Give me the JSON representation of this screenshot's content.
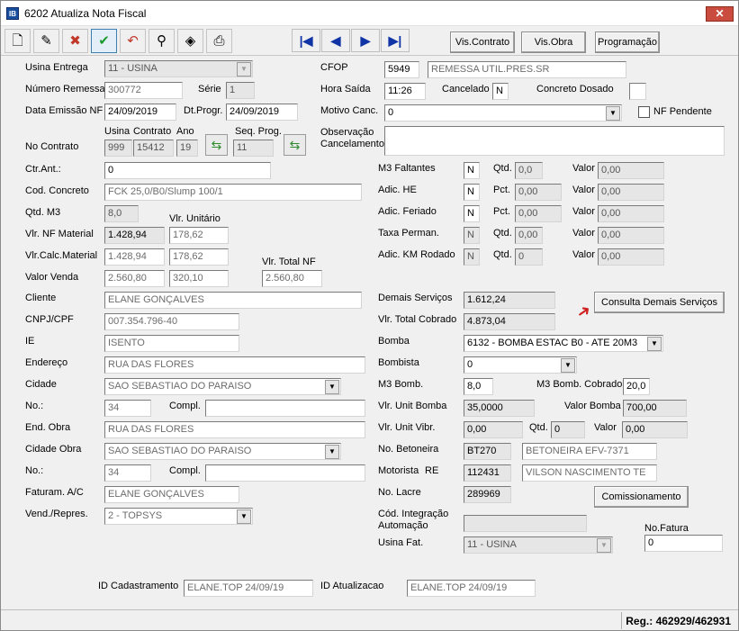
{
  "window": {
    "title": "6202 Atualiza Nota Fiscal",
    "app_icon": "IB",
    "close": "✕"
  },
  "toolbar": {
    "buttons": [
      "new-document-icon",
      "edit-icon",
      "cancel-icon",
      "confirm-check-icon",
      "undo-icon",
      "binoculars-search-icon",
      "eraser-icon",
      "printer-icon"
    ],
    "nav": [
      "first-record-icon",
      "previous-record-icon",
      "next-record-icon",
      "last-record-icon"
    ],
    "vis_contrato": "Vis.Contrato",
    "vis_obra": "Vis.Obra",
    "programacao": "Programação"
  },
  "left": {
    "usina_entrega_label": "Usina Entrega",
    "usina_entrega": "11 - USINA",
    "numero_remessa_label": "Número Remessa",
    "numero_remessa": "300772",
    "serie_label": "Série",
    "serie": "1",
    "data_emissao_label": "Data Emissão NF",
    "data_emissao": "24/09/2019",
    "dt_progr_label": "Dt.Progr.",
    "dt_progr": "24/09/2019",
    "usina_col": "Usina",
    "contrato_col": "Contrato",
    "ano_col": "Ano",
    "no_contrato_label": "No Contrato",
    "contrato_usina": "999",
    "contrato_num": "15412",
    "contrato_ano": "19",
    "seq_prog_label": "Seq. Prog.",
    "seq_prog": "11",
    "ctr_ant_label": "Ctr.Ant.:",
    "ctr_ant": "0",
    "cod_concreto_label": "Cod. Concreto",
    "cod_concreto": "FCK 25,0/B0/Slump 100/1",
    "qtd_m3_label": "Qtd. M3",
    "qtd_m3": "8,0",
    "vlr_unitario_label": "Vlr. Unitário",
    "vlr_nf_material_label": "Vlr. NF Material",
    "vlr_nf_material": "1.428,94",
    "vlr_nf_material_unit": "178,62",
    "vlr_calc_material_label": "Vlr.Calc.Material",
    "vlr_calc_material": "1.428,94",
    "vlr_calc_material_unit": "178,62",
    "vlr_total_nf_label": "Vlr. Total NF",
    "valor_venda_label": "Valor Venda",
    "valor_venda": "2.560,80",
    "valor_venda_unit": "320,10",
    "vlr_total_nf": "2.560,80",
    "cliente_label": "Cliente",
    "cliente": "ELANE GONÇALVES",
    "cnpj_label": "CNPJ/CPF",
    "cnpj": "007.354.796-40",
    "ie_label": "IE",
    "ie": "ISENTO",
    "endereco_label": "Endereço",
    "endereco": "RUA DAS FLORES",
    "cidade_label": "Cidade",
    "cidade": "SAO SEBASTIAO DO PARAISO",
    "no_label": "No.:",
    "no": "34",
    "compl_label": "Compl.",
    "compl": "",
    "end_obra_label": "End. Obra",
    "end_obra": "RUA DAS FLORES",
    "cidade_obra_label": "Cidade Obra",
    "cidade_obra": "SAO SEBASTIAO DO PARAISO",
    "no2_label": "No.:",
    "no2": "34",
    "compl2_label": "Compl.",
    "compl2": "",
    "faturam_label": "Faturam. A/C",
    "faturam": "ELANE GONÇALVES",
    "vend_label": "Vend./Repres.",
    "vend": "2 - TOPSYS"
  },
  "right": {
    "cfop_label": "CFOP",
    "cfop": "5949",
    "cfop_desc": "REMESSA UTIL.PRES.SR",
    "hora_saida_label": "Hora Saída",
    "hora_saida": "11:26",
    "cancelado_label": "Cancelado",
    "cancelado": "N",
    "concreto_dosado_label": "Concreto Dosado",
    "concreto_dosado": "",
    "motivo_canc_label": "Motivo Canc.",
    "motivo_canc": "0",
    "nf_pendente_label": "NF Pendente",
    "observacao_label": "Observação",
    "cancelamento_label": "Cancelamento",
    "observacao": "",
    "m3_faltantes_label": "M3 Faltantes",
    "m3_faltantes": "N",
    "adic_he_label": "Adic. HE",
    "adic_he": "N",
    "adic_feriado_label": "Adic. Feriado",
    "adic_feriado": "N",
    "taxa_perman_label": "Taxa Perman.",
    "taxa_perman": "N",
    "adic_km_label": "Adic. KM Rodado",
    "adic_km": "N",
    "qtd_label": "Qtd.",
    "pct_label": "Pct.",
    "valor_label": "Valor",
    "m3f_qtd": "0,0",
    "m3f_valor": "0,00",
    "he_pct": "0,00",
    "he_valor": "0,00",
    "fer_pct": "0,00",
    "fer_valor": "0,00",
    "tp_qtd": "0,00",
    "tp_valor": "0,00",
    "km_qtd": "0",
    "km_valor": "0,00",
    "demais_servicos_label": "Demais Serviços",
    "demais_servicos": "1.612,24",
    "consulta_demais": "Consulta Demais Serviços",
    "vlr_total_cobrado_label": "Vlr. Total Cobrado",
    "vlr_total_cobrado": "4.873,04",
    "bomba_label": "Bomba",
    "bomba": "6132 - BOMBA ESTAC B0 - ATE 20M3",
    "bombista_label": "Bombista",
    "bombista": "0",
    "m3_bomb_label": "M3 Bomb.",
    "m3_bomb": "8,0",
    "m3_bomb_cobrado_label": "M3 Bomb. Cobrado",
    "m3_bomb_cobrado": "20,0",
    "vlr_unit_bomba_label": "Vlr. Unit Bomba",
    "vlr_unit_bomba": "35,0000",
    "valor_bomba_label": "Valor Bomba",
    "valor_bomba": "700,00",
    "vlr_unit_vibr_label": "Vlr. Unit Vibr.",
    "vlr_unit_vibr": "0,00",
    "vibr_qtd_label": "Qtd.",
    "vibr_qtd": "0",
    "vibr_valor_label": "Valor",
    "vibr_valor": "0,00",
    "no_betoneira_label": "No. Betoneira",
    "no_betoneira": "BT270",
    "betoneira_desc": "BETONEIRA EFV-7371",
    "motorista_label": "Motorista",
    "re_label": "RE",
    "motorista_re": "112431",
    "motorista_nome": "VILSON NASCIMENTO TE",
    "no_lacre_label": "No. Lacre",
    "no_lacre": "289969",
    "comissionamento": "Comissionamento",
    "cod_integracao_label": "Cód. Integração",
    "automacao_label": "Automação",
    "cod_integracao": "",
    "no_fatura_label": "No.Fatura",
    "no_fatura": "0",
    "usina_fat_label": "Usina Fat.",
    "usina_fat": "11 - USINA"
  },
  "footer": {
    "id_cadastramento_label": "ID Cadastramento",
    "id_cadastramento": "ELANE.TOP 24/09/19",
    "id_atualizacao_label": "ID Atualizacao",
    "id_atualizacao": "ELANE.TOP 24/09/19",
    "status": "Reg.: 462929/462931"
  }
}
